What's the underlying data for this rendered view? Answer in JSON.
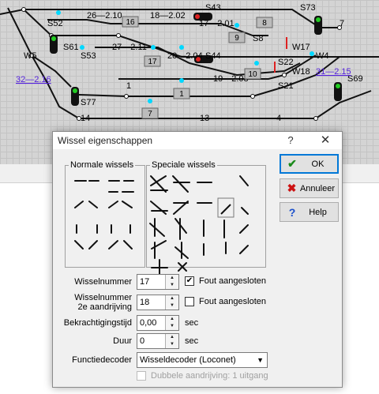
{
  "track": {
    "labels": [
      {
        "id": "s52",
        "text": "S52"
      },
      {
        "id": "s43",
        "text": "S43"
      },
      {
        "id": "s73",
        "text": "S73"
      },
      {
        "id": "t7",
        "text": "7"
      },
      {
        "id": "s61",
        "text": "S61"
      },
      {
        "id": "s53",
        "text": "S53"
      },
      {
        "id": "w5",
        "text": "W5"
      },
      {
        "id": "s8",
        "text": "S8"
      },
      {
        "id": "s44",
        "text": "S44"
      },
      {
        "id": "w17",
        "text": "W17"
      },
      {
        "id": "w4",
        "text": "W4"
      },
      {
        "id": "s22",
        "text": "S22"
      },
      {
        "id": "w18",
        "text": "W18"
      },
      {
        "id": "s21",
        "text": "S21"
      },
      {
        "id": "s69",
        "text": "S69"
      },
      {
        "id": "s77",
        "text": "S77"
      },
      {
        "id": "t1",
        "text": "1"
      },
      {
        "id": "t14",
        "text": "14"
      },
      {
        "id": "t13",
        "text": "13"
      },
      {
        "id": "t4",
        "text": "4"
      },
      {
        "id": "r26",
        "text": "26—2.10"
      },
      {
        "id": "r18",
        "text": "18—2.02"
      },
      {
        "id": "r17",
        "text": "17—2.01"
      },
      {
        "id": "r27",
        "text": "27—2.11"
      },
      {
        "id": "r20",
        "text": "20—2.04"
      },
      {
        "id": "r19",
        "text": "19—2.03"
      }
    ],
    "boxes": [
      {
        "id": "b16",
        "text": "16"
      },
      {
        "id": "b8",
        "text": "8"
      },
      {
        "id": "b9",
        "text": "9"
      },
      {
        "id": "b17",
        "text": "17"
      },
      {
        "id": "b10",
        "text": "10"
      },
      {
        "id": "b1",
        "text": "1"
      },
      {
        "id": "b7",
        "text": "7"
      }
    ],
    "links": [
      {
        "id": "l32",
        "text": "32—2.16"
      },
      {
        "id": "l31",
        "text": "31—2.15"
      }
    ]
  },
  "dialog": {
    "title": "Wissel eigenschappen",
    "help_glyph": "?",
    "close_glyph": "✕",
    "normal_group": "Normale wissels",
    "special_group": "Speciale wissels",
    "buttons": {
      "ok": {
        "label": "OK",
        "icon": "✔"
      },
      "cancel": {
        "label": "Annuleer",
        "icon": "✖"
      },
      "help": {
        "label": "Help",
        "icon": "?"
      }
    },
    "fields": {
      "number_label": "Wisselnummer",
      "number_value": "17",
      "second_label_1": "Wisselnummer",
      "second_label_2": "2e aandrijving",
      "second_value": "18",
      "wrong_connected_1": "Fout aangesloten",
      "wrong_connected_1_checked": "✔",
      "wrong_connected_2": "Fout aangesloten",
      "power_time_label": "Bekrachtigingstijd",
      "power_time_value": "0,00",
      "power_time_unit": "sec",
      "duration_label": "Duur",
      "duration_value": "0",
      "duration_unit": "sec",
      "decoder_label": "Functiedecoder",
      "decoder_value": "Wisseldecoder (Loconet)",
      "double_drive": "Dubbele aandrijving: 1 uitgang"
    }
  }
}
